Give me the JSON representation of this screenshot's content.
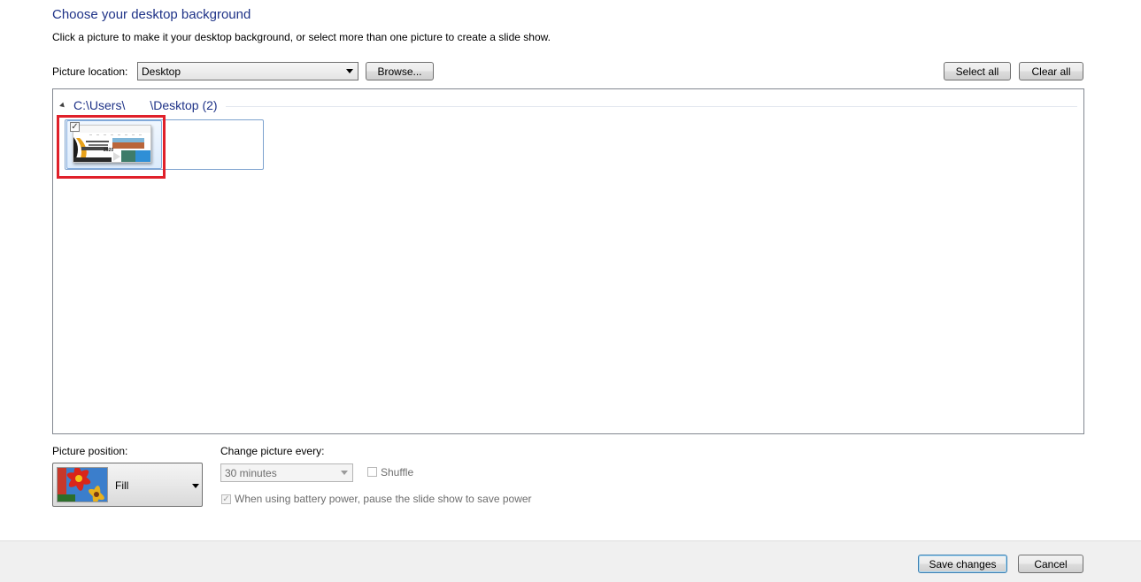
{
  "header": {
    "title": "Choose your desktop background",
    "subtitle": "Click a picture to make it your desktop background, or select more than one picture to create a slide show."
  },
  "location": {
    "label": "Picture location:",
    "selected": "Desktop",
    "browse_label": "Browse...",
    "select_all_label": "Select all",
    "clear_all_label": "Clear all"
  },
  "gallery": {
    "group_path_prefix": "C:\\Users\\",
    "group_path_suffix": "\\Desktop (2)",
    "items": [
      {
        "checked": true,
        "thumb_text": "2020"
      }
    ]
  },
  "position": {
    "label": "Picture position:",
    "selected": "Fill"
  },
  "slideshow": {
    "label": "Change picture every:",
    "interval": "30 minutes",
    "shuffle_label": "Shuffle",
    "battery_label": "When using battery power, pause the slide show to save power",
    "battery_checked": true
  },
  "footer": {
    "save_label": "Save changes",
    "cancel_label": "Cancel"
  },
  "colors": {
    "title": "#1e3287",
    "highlight": "#e0202a"
  }
}
